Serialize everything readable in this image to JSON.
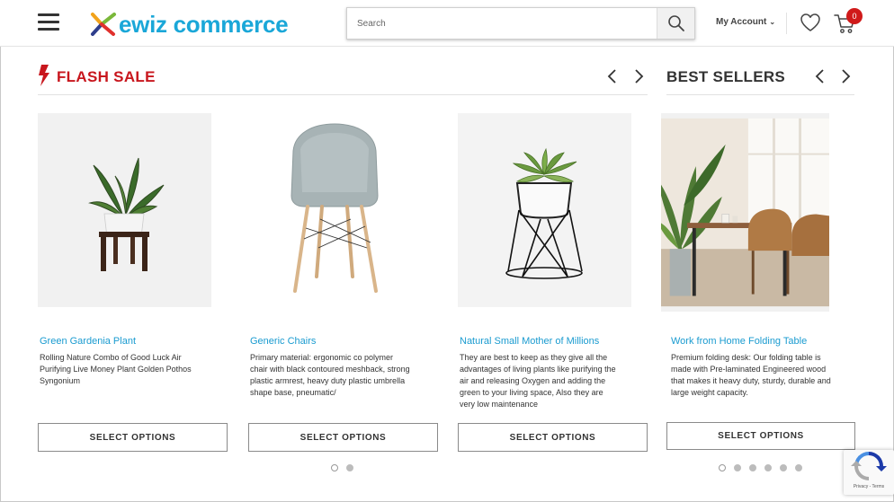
{
  "header": {
    "brand": "ewiz commerce",
    "search_placeholder": "Search",
    "account_label": "My Account",
    "cart_count": "0"
  },
  "flash_sale": {
    "title": "FLASH SALE",
    "products": [
      {
        "name": "Green Gardenia Plant",
        "description": "Rolling Nature Combo of Good Luck Air Purifying Live Money Plant Golden Pothos Syngonium",
        "button": "SELECT OPTIONS"
      },
      {
        "name": "Generic Chairs",
        "description": "Primary material: ergonomic co polymer chair with black contoured meshback, strong plastic armrest, heavy duty plastic umbrella shape base, pneumatic/",
        "button": "SELECT OPTIONS"
      },
      {
        "name": "Natural Small Mother of Millions",
        "description": "They are best to keep as they give all the advantages of living plants like purifying the air and releasing Oxygen and adding the green to your living space, Also they are very low maintenance",
        "button": "SELECT OPTIONS"
      }
    ]
  },
  "best_sellers": {
    "title": "BEST SELLERS",
    "products": [
      {
        "name": "Work from Home Folding Table",
        "description": "Premium folding desk: Our folding table is made with Pre-laminated Engineered wood that makes it heavy duty, sturdy, durable and large weight capacity.",
        "button": "SELECT OPTIONS"
      }
    ]
  },
  "recaptcha": {
    "footer": "Privacy - Terms"
  },
  "colors": {
    "brand_blue": "#1aa7d8",
    "flash_red": "#c8161d",
    "badge_red": "#d01a1a",
    "link_blue": "#1a9bd0"
  }
}
